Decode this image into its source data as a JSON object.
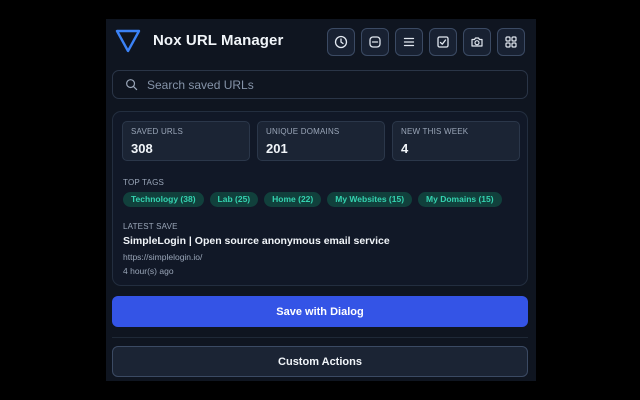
{
  "header": {
    "title": "Nox URL Manager",
    "toolbar": [
      {
        "icon": "clock-icon"
      },
      {
        "icon": "minus-box-icon"
      },
      {
        "icon": "list-icon"
      },
      {
        "icon": "check-note-icon"
      },
      {
        "icon": "camera-icon"
      },
      {
        "icon": "grid-icon"
      }
    ]
  },
  "search": {
    "placeholder": "Search saved URLs",
    "value": ""
  },
  "stats": [
    {
      "label": "SAVED URLS",
      "value": "308"
    },
    {
      "label": "UNIQUE DOMAINS",
      "value": "201"
    },
    {
      "label": "NEW THIS WEEK",
      "value": "4"
    }
  ],
  "top_tags": {
    "label": "TOP TAGS",
    "tags": [
      "Technology (38)",
      "Lab (25)",
      "Home (22)",
      "My Websites (15)",
      "My Domains (15)"
    ]
  },
  "latest_save": {
    "label": "LATEST SAVE",
    "title": "SimpleLogin | Open source anonymous email service",
    "url": "https://simplelogin.io/",
    "time": "4 hour(s) ago"
  },
  "actions": {
    "primary_label": "Save with Dialog",
    "secondary_label": "Custom Actions"
  },
  "colors": {
    "accent": "#3454e6",
    "tag_text": "#34d3b0",
    "tag_bg": "#11403c",
    "background": "#0f1520"
  }
}
